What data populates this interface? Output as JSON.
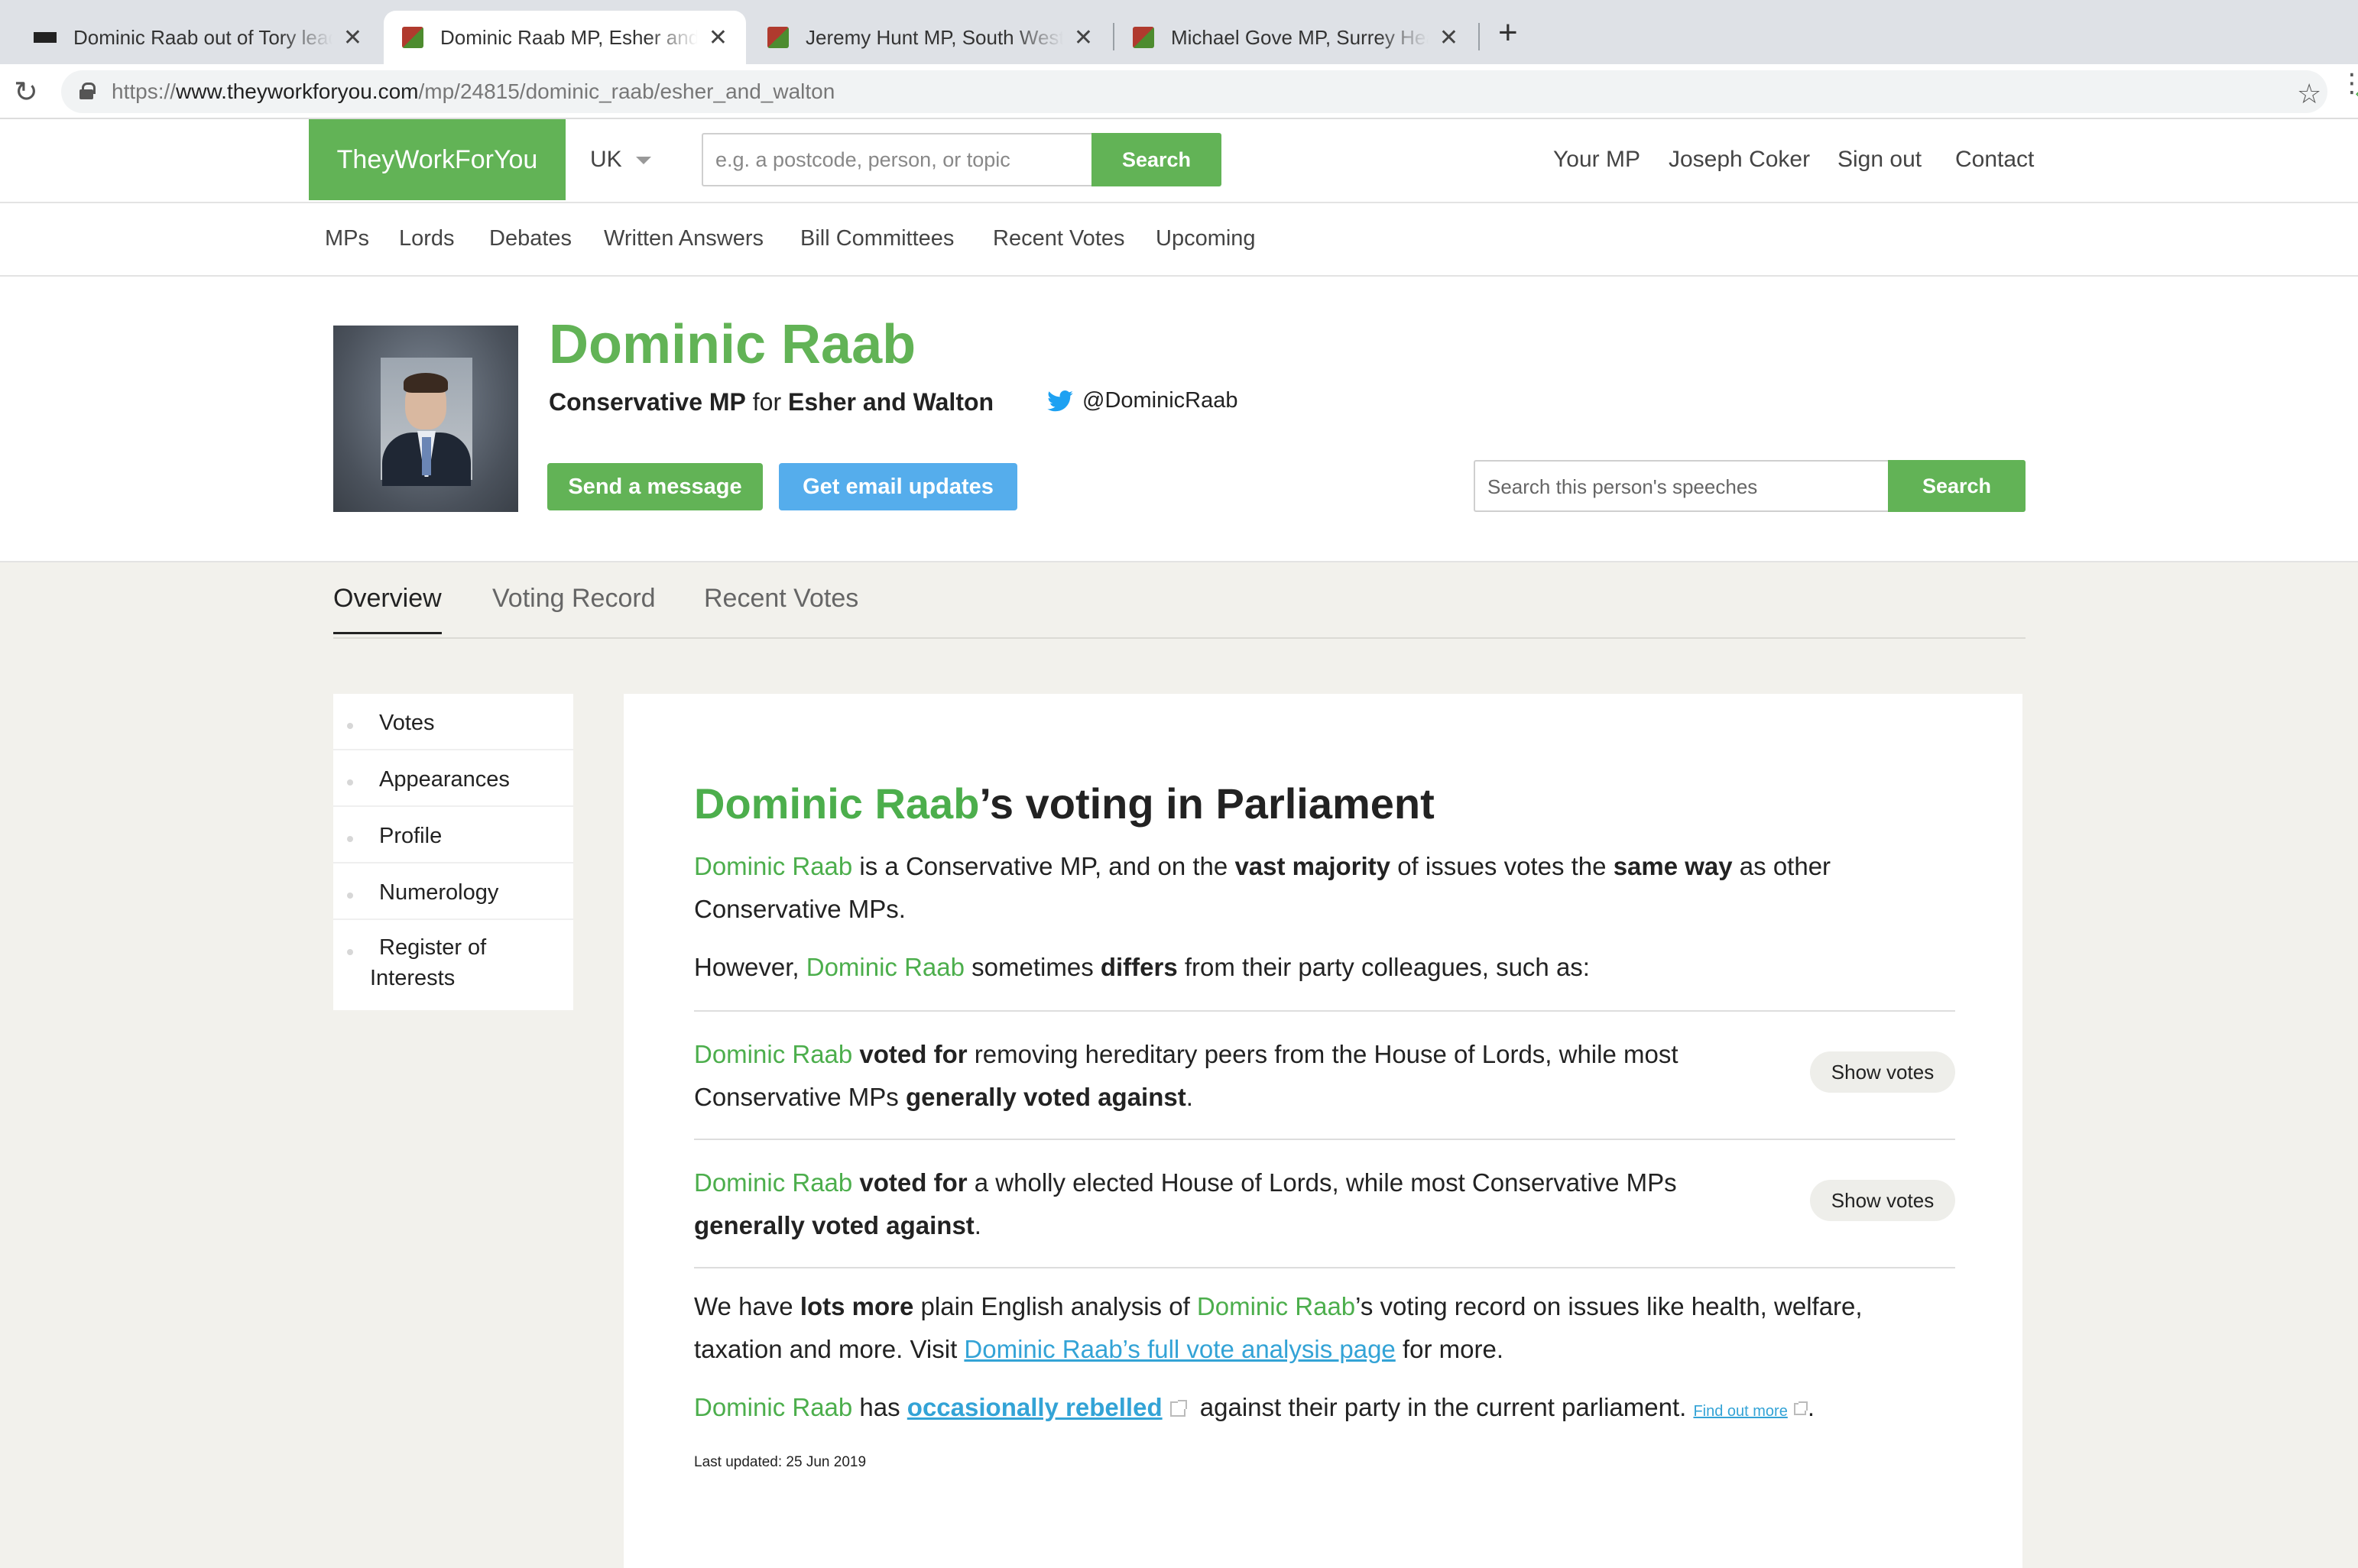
{
  "browser": {
    "tabs": [
      {
        "title": "Dominic Raab out of Tory leadership race",
        "favicon": "bbc"
      },
      {
        "title": "Dominic Raab MP, Esher and Walton - TheyWorkForYou",
        "favicon": "twfy"
      },
      {
        "title": "Jeremy Hunt MP, South West Surrey - TheyWorkForYou",
        "favicon": "twfy"
      },
      {
        "title": "Michael Gove MP, Surrey Heath - TheyWorkForYou",
        "favicon": "twfy"
      }
    ],
    "url_prefix": "https://",
    "url_domain": "www.theyworkforyou.com",
    "url_path": "/mp/24815/dominic_raab/esher_and_walton"
  },
  "site": {
    "logo": "TheyWorkForYou",
    "region": "UK",
    "search_placeholder": "e.g. a postcode, person, or topic",
    "search_button": "Search",
    "top_links": [
      "Your MP",
      "Joseph Coker",
      "Sign out",
      "Contact"
    ],
    "nav": [
      "MPs",
      "Lords",
      "Debates",
      "Written Answers",
      "Bill Committees",
      "Recent Votes",
      "Upcoming"
    ]
  },
  "person": {
    "name": "Dominic Raab",
    "party_role": "Conservative MP",
    "for_word": "for",
    "constituency": "Esher and Walton",
    "twitter": "@DominicRaab",
    "send_message": "Send a message",
    "email_updates": "Get email updates",
    "speech_search_placeholder": "Search this person's speeches",
    "speech_search_button": "Search"
  },
  "profile_tabs": [
    "Overview",
    "Voting Record",
    "Recent Votes"
  ],
  "side_menu": [
    "Votes",
    "Appearances",
    "Profile",
    "Numerology",
    "Register of",
    "Interests"
  ],
  "voting": {
    "heading_rest": "’s voting in Parliament",
    "intro_1": " is a Conservative MP, and on the ",
    "intro_b1": "vast majority",
    "intro_2": " of issues votes the ",
    "intro_b2": "same way",
    "intro_3": " as other Conservative MPs.",
    "however_1": "However, ",
    "however_2": " sometimes ",
    "however_b": "differs",
    "however_3": " from their party colleagues, such as:",
    "vote1_b1": "voted for",
    "vote1_t1": " removing hereditary peers from the House of Lords, while most Conservative MPs ",
    "vote1_b2": "generally voted against",
    "vote2_b1": "voted for",
    "vote2_t1": " a wholly elected House of Lords, while most Conservative MPs ",
    "vote2_b2": "generally voted against",
    "show_votes": "Show votes",
    "more_1": "We have ",
    "more_b": "lots more",
    "more_2": " plain English analysis of ",
    "more_3": "’s voting record on issues like health, welfare, taxation and more. Visit ",
    "more_link": "Dominic Raab’s full vote analysis page",
    "more_4": " for more.",
    "rebel_1": " has ",
    "rebel_link": "occasionally rebelled",
    "rebel_2": " against their party in the current parliament. ",
    "find_out_more": "Find out more",
    "last_updated": "Last updated: 25 Jun 2019"
  }
}
